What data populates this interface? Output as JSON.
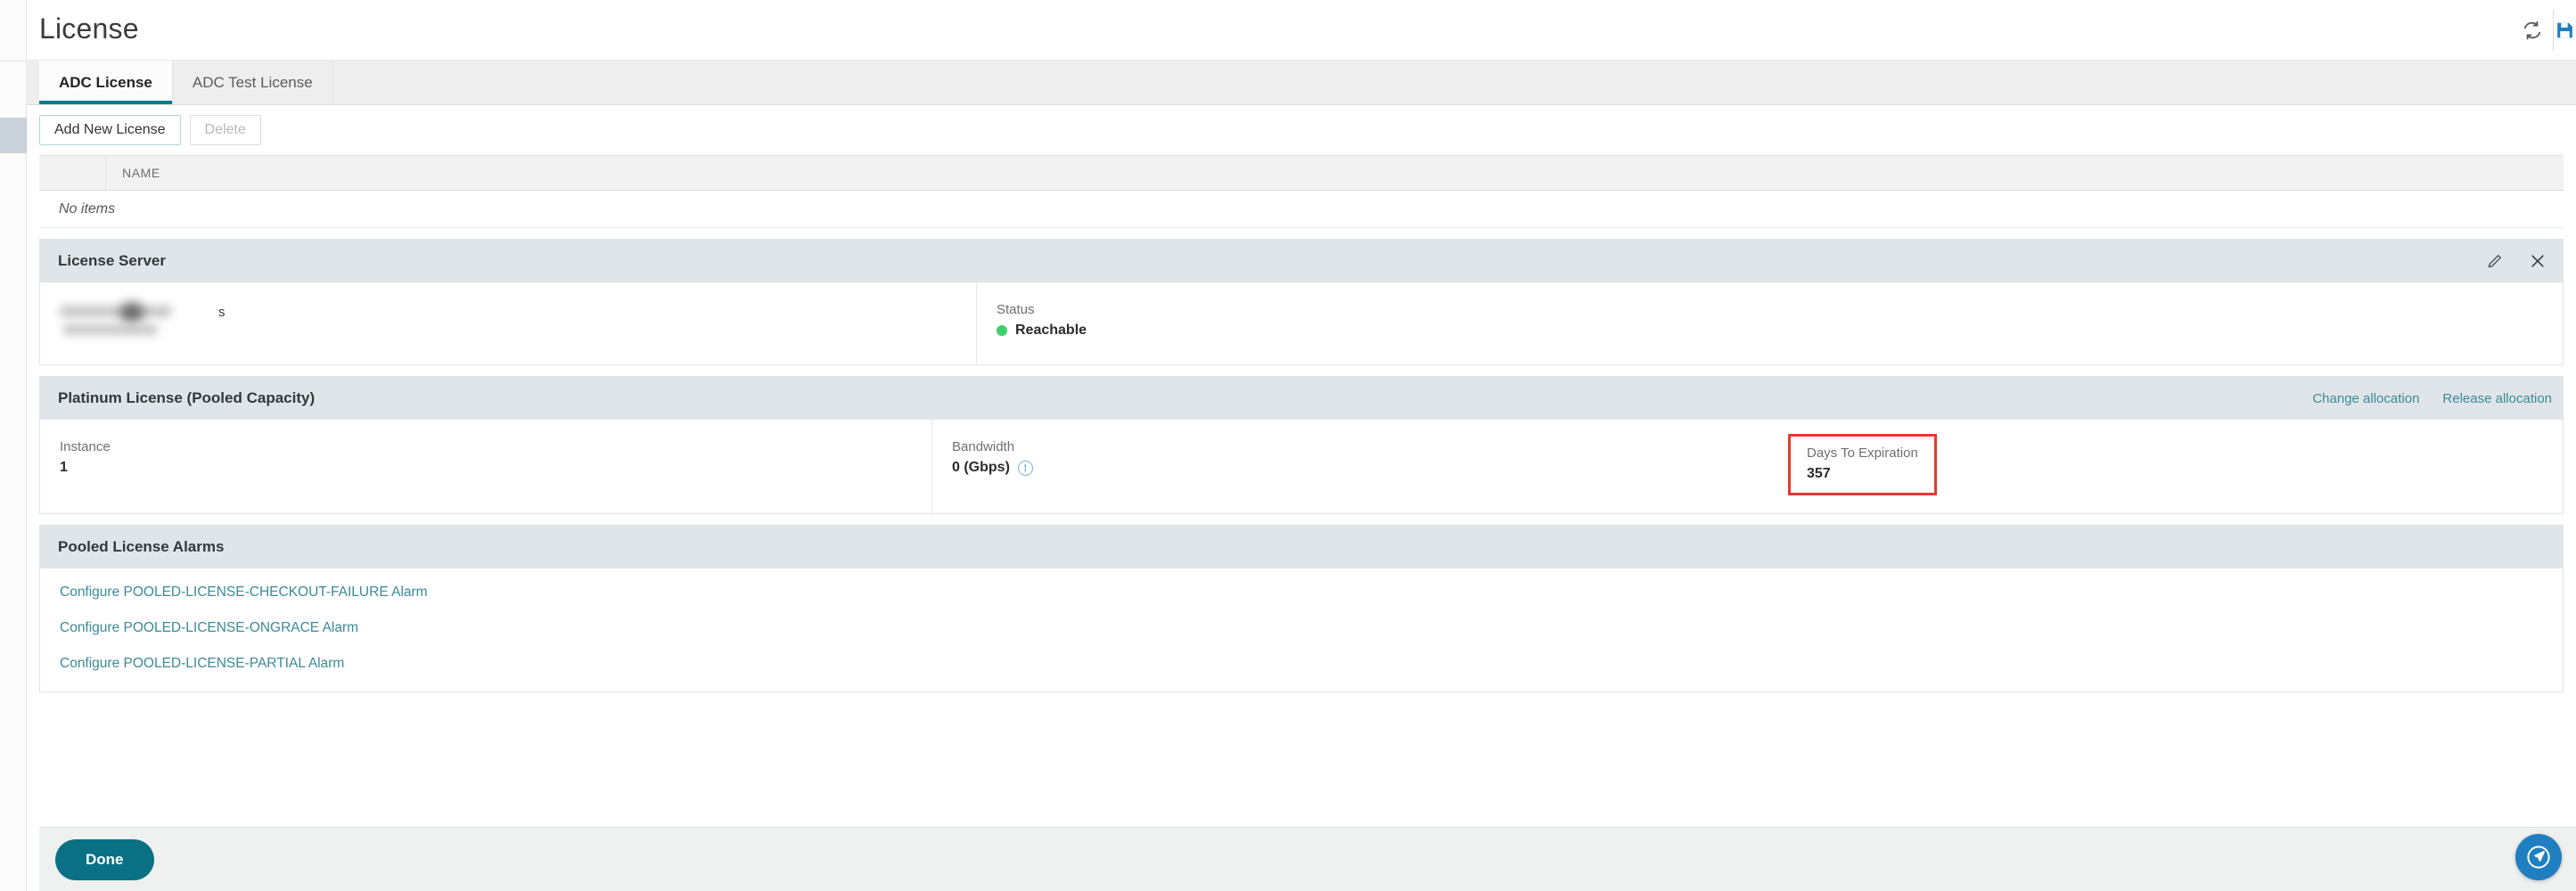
{
  "header": {
    "title": "License",
    "actions": [
      {
        "name": "refresh-icon",
        "label": "Refresh"
      },
      {
        "name": "export-icon",
        "label": "Export"
      }
    ]
  },
  "tabs": [
    {
      "label": "ADC License",
      "active": true
    },
    {
      "label": "ADC Test License",
      "active": false
    }
  ],
  "toolbar": {
    "add_label": "Add New License",
    "delete_label": "Delete"
  },
  "grid": {
    "columns": [
      "",
      "NAME"
    ],
    "name_header": "NAME",
    "empty_text": "No items"
  },
  "license_server": {
    "title": "License Server",
    "server_name_visible_tail": "s",
    "status_label": "Status",
    "status_value": "Reachable",
    "status_color": "#3ecf6d",
    "edit_icon": "pencil-icon",
    "close_icon": "close-icon"
  },
  "platinum": {
    "title": "Platinum License (Pooled Capacity)",
    "links": [
      {
        "label": "Change allocation"
      },
      {
        "label": "Release allocation"
      }
    ],
    "fields": [
      {
        "label": "Instance",
        "value": "1"
      },
      {
        "label": "Bandwidth",
        "value": "0 (Gbps)",
        "info": true
      },
      {
        "label": "Days To Expiration",
        "value": "357",
        "highlighted": true
      }
    ],
    "highlight_color": "#e8372e"
  },
  "alarms": {
    "title": "Pooled License Alarms",
    "items": [
      {
        "label": "Configure POOLED-LICENSE-CHECKOUT-FAILURE Alarm"
      },
      {
        "label": "Configure POOLED-LICENSE-ONGRACE Alarm"
      },
      {
        "label": "Configure POOLED-LICENSE-PARTIAL Alarm"
      }
    ]
  },
  "footer": {
    "done_label": "Done",
    "fab_icon": "navigation-send-icon"
  },
  "theme": {
    "accent": "#0a7b8c",
    "link": "#3b8a97",
    "primary_button": "#0a7184",
    "fab": "#1f7fc0"
  }
}
